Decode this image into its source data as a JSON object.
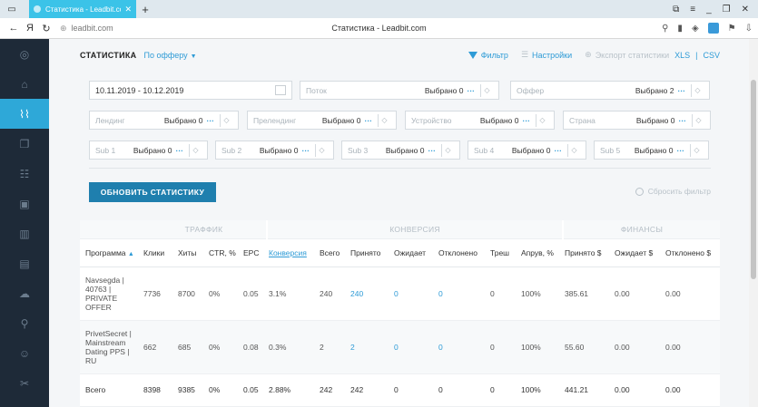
{
  "browser": {
    "tab_title": "Статистика - Leadbit.com",
    "tab_close": "✕",
    "new_tab": "+",
    "url": "leadbit.com",
    "page_title": "Статистика - Leadbit.com"
  },
  "sidebar": {
    "items": [
      {
        "icon": "target-icon",
        "glyph": "◎"
      },
      {
        "icon": "home-icon",
        "glyph": "⌂"
      },
      {
        "icon": "stats-icon",
        "glyph": "📈"
      },
      {
        "icon": "copy-icon",
        "glyph": "❐"
      },
      {
        "icon": "users-icon",
        "glyph": "☷"
      },
      {
        "icon": "box-icon",
        "glyph": "▣"
      },
      {
        "icon": "building-icon",
        "glyph": "▥"
      },
      {
        "icon": "card-icon",
        "glyph": "▤"
      },
      {
        "icon": "cloud-icon",
        "glyph": "☁"
      },
      {
        "icon": "link-icon",
        "glyph": "⚲"
      },
      {
        "icon": "user-icon",
        "glyph": "☺"
      },
      {
        "icon": "tools-icon",
        "glyph": "✂"
      }
    ]
  },
  "header": {
    "title": "СТАТИСТИКА",
    "group_by": "По офферу",
    "filter_label": "Фильтр",
    "settings_label": "Настройки",
    "export_label": "Экспорт статистики",
    "export_xls": "XLS",
    "export_sep": "|",
    "export_csv": "CSV"
  },
  "filters": {
    "date_range": "10.11.2019 - 10.12.2019",
    "flow": {
      "label": "Поток",
      "value": "Выбрано 0"
    },
    "offer": {
      "label": "Оффер",
      "value": "Выбрано 2"
    },
    "landing": {
      "label": "Лендинг",
      "value": "Выбрано 0"
    },
    "prelanding": {
      "label": "Прелендинг",
      "value": "Выбрано 0"
    },
    "device": {
      "label": "Устройство",
      "value": "Выбрано 0"
    },
    "country": {
      "label": "Страна",
      "value": "Выбрано 0"
    },
    "sub1": {
      "label": "Sub 1",
      "value": "Выбрано 0"
    },
    "sub2": {
      "label": "Sub 2",
      "value": "Выбрано 0"
    },
    "sub3": {
      "label": "Sub 3",
      "value": "Выбрано 0"
    },
    "sub4": {
      "label": "Sub 4",
      "value": "Выбрано 0"
    },
    "sub5": {
      "label": "Sub 5",
      "value": "Выбрано 0"
    },
    "more": "···",
    "refresh_button": "ОБНОВИТЬ СТАТИСТИКУ",
    "reset_label": "Сбросить фильтр"
  },
  "table": {
    "groups": {
      "traffic": "ТРАФФИК",
      "conversion": "КОНВЕРСИЯ",
      "finance": "ФИНАНСЫ"
    },
    "columns": {
      "program": "Программа",
      "clicks": "Клики",
      "hits": "Хиты",
      "ctr": "CTR, %",
      "epc": "EPC",
      "conversion": "Конверсия",
      "total": "Всего",
      "accepted": "Принято",
      "pending": "Ожидает",
      "rejected": "Отклонено",
      "trash": "Треш",
      "approve": "Апрув, %",
      "accepted_money": "Принято $",
      "pending_money": "Ожидает $",
      "rejected_money": "Отклонено $"
    },
    "rows": [
      {
        "program": "Navsegda | 40763 | PRIVATE OFFER",
        "clicks": "7736",
        "hits": "8700",
        "ctr": "0%",
        "epc": "0.05",
        "conversion": "3.1%",
        "total": "240",
        "accepted": "240",
        "pending": "0",
        "rejected": "0",
        "trash": "0",
        "approve": "100%",
        "accepted_money": "385.61",
        "pending_money": "0.00",
        "rejected_money": "0.00"
      },
      {
        "program": "PrivetSecret | Mainstream Dating PPS | RU",
        "clicks": "662",
        "hits": "685",
        "ctr": "0%",
        "epc": "0.08",
        "conversion": "0.3%",
        "total": "2",
        "accepted": "2",
        "pending": "0",
        "rejected": "0",
        "trash": "0",
        "approve": "100%",
        "accepted_money": "55.60",
        "pending_money": "0.00",
        "rejected_money": "0.00"
      }
    ],
    "totals": {
      "program": "Всего",
      "clicks": "8398",
      "hits": "9385",
      "ctr": "0%",
      "epc": "0.05",
      "conversion": "2.88%",
      "total": "242",
      "accepted": "242",
      "pending": "0",
      "rejected": "0",
      "trash": "0",
      "approve": "100%",
      "accepted_money": "441.21",
      "pending_money": "0.00",
      "rejected_money": "0.00"
    }
  },
  "colors": {
    "accent": "#2e9bd6",
    "sidebar": "#1e2a38",
    "active": "#2ea8d8",
    "button": "#1f7fae"
  }
}
